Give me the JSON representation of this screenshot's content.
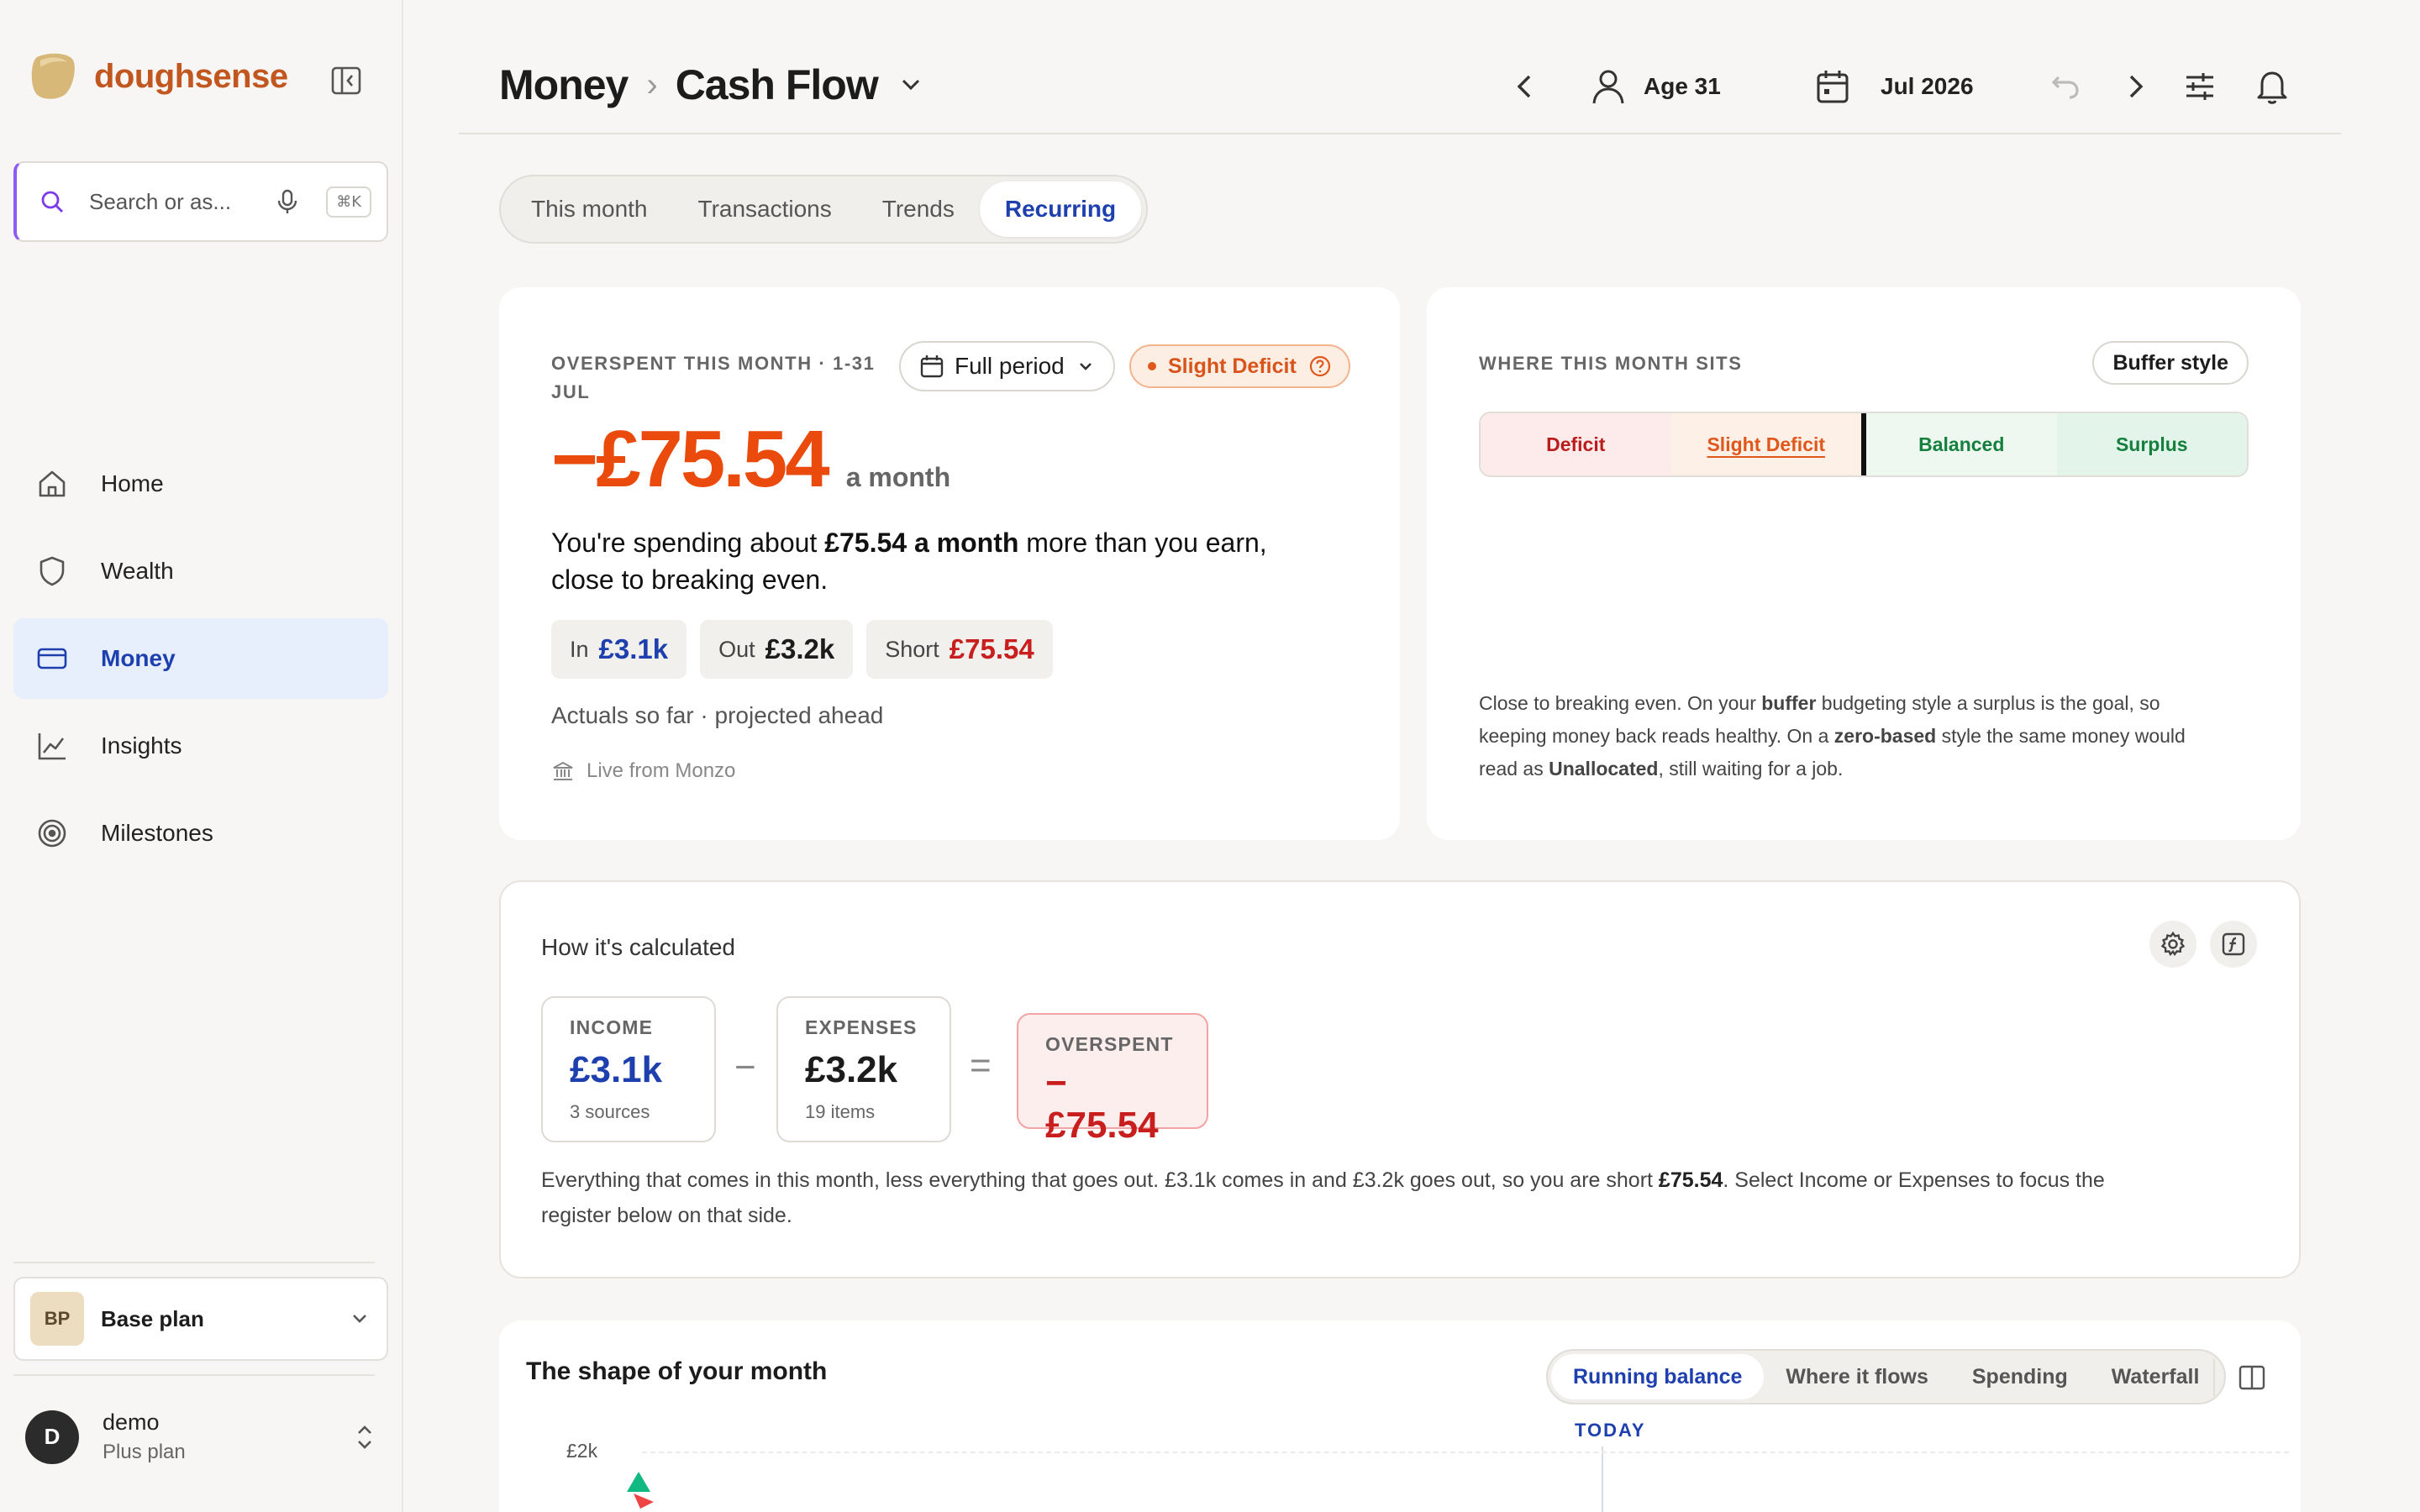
{
  "brand": {
    "name": "doughsense"
  },
  "search": {
    "placeholder": "Search or as...",
    "shortcut": "⌘K"
  },
  "nav": [
    {
      "label": "Home",
      "icon": "home-icon"
    },
    {
      "label": "Wealth",
      "icon": "shield-icon"
    },
    {
      "label": "Money",
      "icon": "card-icon",
      "active": true
    },
    {
      "label": "Insights",
      "icon": "chart-icon"
    },
    {
      "label": "Milestones",
      "icon": "target-icon"
    }
  ],
  "plan": {
    "initials": "BP",
    "name": "Base plan"
  },
  "user": {
    "initial": "D",
    "name": "demo",
    "plan": "Plus plan"
  },
  "header": {
    "crumb_parent": "Money",
    "crumb_current": "Cash Flow",
    "age": "Age 31",
    "month": "Jul 2026"
  },
  "tabs": [
    {
      "label": "This month"
    },
    {
      "label": "Transactions"
    },
    {
      "label": "Trends"
    },
    {
      "label": "Recurring",
      "active": true
    }
  ],
  "summary": {
    "eyebrow_line1": "OVERSPENT THIS MONTH · 1-31",
    "eyebrow_line2": "JUL",
    "period_button": "Full period",
    "status_badge": "Slight Deficit",
    "amount": "−£75.54",
    "amount_suffix": "a month",
    "desc_pre": "You're spending about ",
    "desc_bold": "£75.54 a month",
    "desc_post": " more than you earn,",
    "desc_line2": "close to breaking even.",
    "chips": [
      {
        "label": "In",
        "value": "£3.1k",
        "color": "#1e40af"
      },
      {
        "label": "Out",
        "value": "£3.2k",
        "color": "#1c1c1c"
      },
      {
        "label": "Short",
        "value": "£75.54",
        "color": "#c81e1e"
      }
    ],
    "note": "Actuals so far · projected ahead",
    "source": "Live from Monzo"
  },
  "position": {
    "eyebrow": "WHERE THIS MONTH SITS",
    "style_button": "Buffer style",
    "segments": [
      {
        "label": "Deficit",
        "bg": "#fdeaea",
        "fg": "#b91c1c"
      },
      {
        "label": "Slight Deficit",
        "bg": "#fdf0e6",
        "fg": "#e0571c",
        "current": true
      },
      {
        "label": "Balanced",
        "bg": "#eef8f1",
        "fg": "#15803d"
      },
      {
        "label": "Surplus",
        "bg": "#e3f5ea",
        "fg": "#15803d"
      }
    ],
    "explain_1": "Close to breaking even. On your ",
    "explain_b1": "buffer",
    "explain_2": " budgeting style a surplus is the goal, so",
    "explain_3": "keeping money back reads healthy. On a ",
    "explain_b2": "zero-based",
    "explain_4": " style the same money would",
    "explain_5": "read as ",
    "explain_b3": "Unallocated",
    "explain_6": ", still waiting for a job."
  },
  "calc": {
    "title": "How it's calculated",
    "income": {
      "key": "INCOME",
      "value": "£3.1k",
      "sub": "3 sources"
    },
    "minus": "−",
    "expenses": {
      "key": "EXPENSES",
      "value": "£3.2k",
      "sub": "19 items"
    },
    "equals": "=",
    "result": {
      "key": "OVERSPENT",
      "value": "−£75.54"
    },
    "text_1": "Everything that comes in this month, less everything that goes out. £3.1k comes in and £3.2k goes out, so you are short ",
    "text_bold": "£75.54",
    "text_2": ". Select Income or Expenses to focus the",
    "text_3": "register below on that side."
  },
  "shape": {
    "title": "The shape of your month",
    "tabs": [
      {
        "label": "Running balance",
        "active": true
      },
      {
        "label": "Where it flows"
      },
      {
        "label": "Spending"
      },
      {
        "label": "Waterfall"
      }
    ],
    "today_label": "TODAY",
    "y_tick": "£2k"
  },
  "colors": {
    "accent": "#1e40af",
    "brand": "#c2561f",
    "deficit": "#ea4a0c",
    "negative": "#c81e1e"
  }
}
